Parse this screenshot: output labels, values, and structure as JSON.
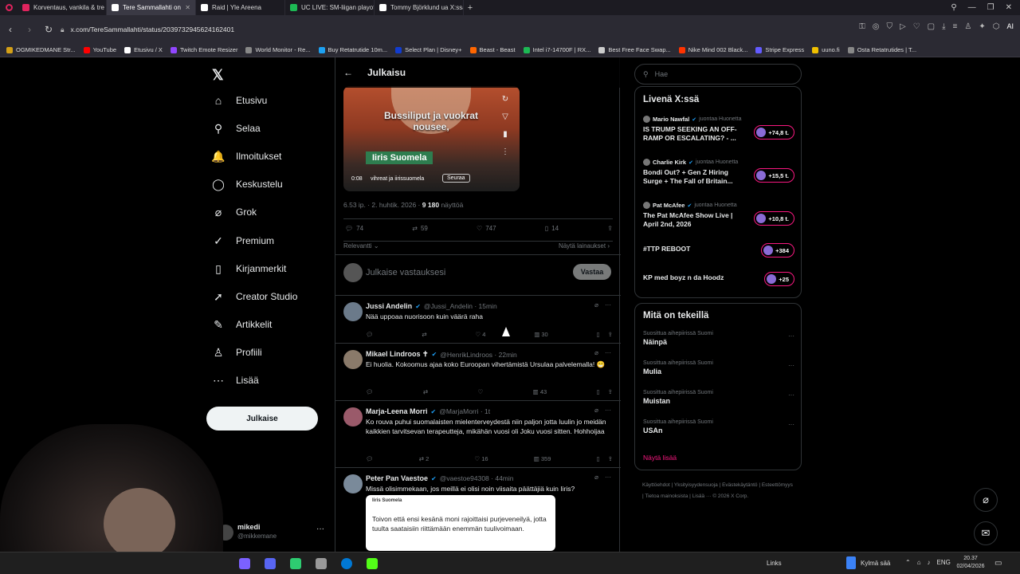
{
  "browser": {
    "tabs": [
      {
        "label": "Korventaus, vankila & tre",
        "color": "#e0245e"
      },
      {
        "label": "Tere Sammallahti on",
        "color": "#ffffff"
      },
      {
        "label": "Raid | Yle Areena",
        "color": "#ffffff"
      },
      {
        "label": "UC LIVE: SM-liigan playoff",
        "color": "#1db954"
      },
      {
        "label": "Tommy Björklund ua X:ssä",
        "color": "#ffffff"
      }
    ],
    "url": "x.com/TereSammallahti/status/2039732945624162401",
    "bookmarks": [
      {
        "label": "OGMIKEDMANE Str...",
        "color": "#d4a017"
      },
      {
        "label": "YouTube",
        "color": "#ff0000"
      },
      {
        "label": "Etusivu / X",
        "color": "#ffffff"
      },
      {
        "label": "Twitch Emote Resizer",
        "color": "#9146ff"
      },
      {
        "label": "World Monitor - Re...",
        "color": "#888888"
      },
      {
        "label": "Buy Retatrutide 10m...",
        "color": "#1da1f2"
      },
      {
        "label": "Select Plan | Disney+",
        "color": "#113ccf"
      },
      {
        "label": "Beast - Beast",
        "color": "#ff6600"
      },
      {
        "label": "Intel i7-14700F | RX...",
        "color": "#1db954"
      },
      {
        "label": "Best Free Face Swap...",
        "color": "#cccccc"
      },
      {
        "label": "Nike Mind 002 Black...",
        "color": "#ff3300"
      },
      {
        "label": "Stripe Express",
        "color": "#635bff"
      },
      {
        "label": "uuno.fi",
        "color": "#f0c000"
      },
      {
        "label": "Osta Retatrutides | T...",
        "color": "#888888"
      }
    ]
  },
  "nav": {
    "items": [
      {
        "label": "Etusivu",
        "icon": "home-icon",
        "glyph": "⌂"
      },
      {
        "label": "Selaa",
        "icon": "search-icon",
        "glyph": "⚲"
      },
      {
        "label": "Ilmoitukset",
        "icon": "bell-icon",
        "glyph": "🔔"
      },
      {
        "label": "Keskustelu",
        "icon": "chat-icon",
        "glyph": "◯"
      },
      {
        "label": "Grok",
        "icon": "grok-icon",
        "glyph": "⌀"
      },
      {
        "label": "Premium",
        "icon": "premium-icon",
        "glyph": "✓"
      },
      {
        "label": "Kirjanmerkit",
        "icon": "bookmark-icon",
        "glyph": "▯"
      },
      {
        "label": "Creator Studio",
        "icon": "rocket-icon",
        "glyph": "➚"
      },
      {
        "label": "Artikkelit",
        "icon": "article-icon",
        "glyph": "✎"
      },
      {
        "label": "Profiili",
        "icon": "profile-icon",
        "glyph": "♙"
      },
      {
        "label": "Lisää",
        "icon": "more-icon",
        "glyph": "⋯"
      }
    ],
    "post_button": "Julkaise",
    "account_name": "mikedi",
    "account_handle": "@mikkemane"
  },
  "post": {
    "header_title": "Julkaisu",
    "video_caption": "Bussiliput ja vuokrat\nnousee,",
    "video_name_tag": "Iiris Suomela",
    "video_time": "0:08",
    "video_source": "vihreat ja iirissuomela",
    "video_follow": "Seuraa",
    "timestamp": "6.53 ip. · 2. huhtik. 2026 ·",
    "views_count": "9 180",
    "views_label": "näyttöä",
    "stats": {
      "replies": "74",
      "reposts": "59",
      "likes": "747",
      "bookmarks": "14"
    },
    "sort_label": "Relevantti",
    "show_quotes": "Näytä lainaukset",
    "reply_placeholder": "Julkaise vastauksesi",
    "reply_button": "Vastaa"
  },
  "replies": [
    {
      "name": "Jussi Andelin",
      "handle": "@Jussi_Andelin · 15min",
      "text": "Nää uppoaa nuorisoon kuin väärä raha",
      "likes": "4",
      "views": "30",
      "avatar": "#6b7a8a"
    },
    {
      "name": "Mikael Lindroos ✝",
      "handle": "@HenrikLindroos · 22min",
      "text": "Ei huolia. Kokoomus ajaa koko Euroopan vihertämistä Ursulaa palvelemalla! 😁",
      "likes": "",
      "views": "43",
      "avatar": "#8a7a6a"
    },
    {
      "name": "Marja-Leena Morri",
      "handle": "@MarjaMorri · 1t",
      "text": "Ko rouva puhui suomalaisten mielenterveydestä niin paljon jotta luulin jo meidän kaikkien tarvitsevan terapeutteja, mikähän vuosi oli Joku vuosi sitten. Hohhoijaa",
      "reposts": "2",
      "likes": "16",
      "views": "359",
      "avatar": "#9a5a6a"
    },
    {
      "name": "Peter Pan Vaestoe",
      "handle": "@vaestoe94308 · 44min",
      "text": "Missä olisimmekaan, jos meillä ei olisi noin viisaita päättäjiä kuin Iiris?",
      "quote": "Toivon että ensi kesänä moni rajoittaisi purjeveneilyä, jotta tuulta saataisiin riittämään enemmän tuulivoimaan.",
      "quote_author": "Iiris Suomela",
      "avatar": "#7a8a9a"
    }
  ],
  "right": {
    "search_placeholder": "Hae",
    "live_title": "Livenä X:ssä",
    "live": [
      {
        "host": "Mario Nawfal",
        "sub": "juontaa Huonetta",
        "title": "IS TRUMP SEEKING AN OFF-RAMP OR ESCALATING? - ...",
        "count": "+74,8 t."
      },
      {
        "host": "Charlie Kirk",
        "sub": "juontaa Huonetta",
        "title": "Bondi Out? + Gen Z Hiring Surge + The Fall of Britain...",
        "count": "+15,5 t."
      },
      {
        "host": "Pat McAfee",
        "sub": "juontaa Huonetta",
        "title": "The Pat McAfee Show Live | April 2nd, 2026",
        "count": "+10,8 t."
      },
      {
        "host": "",
        "sub": "",
        "title": "#TTP REBOOT",
        "count": "+384"
      },
      {
        "host": "",
        "sub": "",
        "title": "KP med boyz n da Hoodz",
        "count": "+25"
      }
    ],
    "trends_title": "Mitä on tekeillä",
    "trends": [
      {
        "sub": "Suosittua aihepiirissä Suomi",
        "name": "Näinpä"
      },
      {
        "sub": "Suosittua aihepiirissä Suomi",
        "name": "Mulia"
      },
      {
        "sub": "Suosittua aihepiirissä Suomi",
        "name": "Muistan"
      },
      {
        "sub": "Suosittua aihepiirissä Suomi",
        "name": "USAn"
      }
    ],
    "show_more": "Näytä lisää",
    "footer": "Käyttöehdot | Yksityisyydensuoja | Evästekäytäntö | Esteettömyys | Tietoa mainoksista | Lisää ··· © 2026 X Corp."
  },
  "taskbar": {
    "links": "Links",
    "weather": "Kylmä sää",
    "lang": "ENG",
    "time": "20.37",
    "date": "02/04/2026"
  },
  "colors": {
    "accent": "#1d9bf0",
    "like": "#f91880",
    "border": "#2f3336"
  }
}
